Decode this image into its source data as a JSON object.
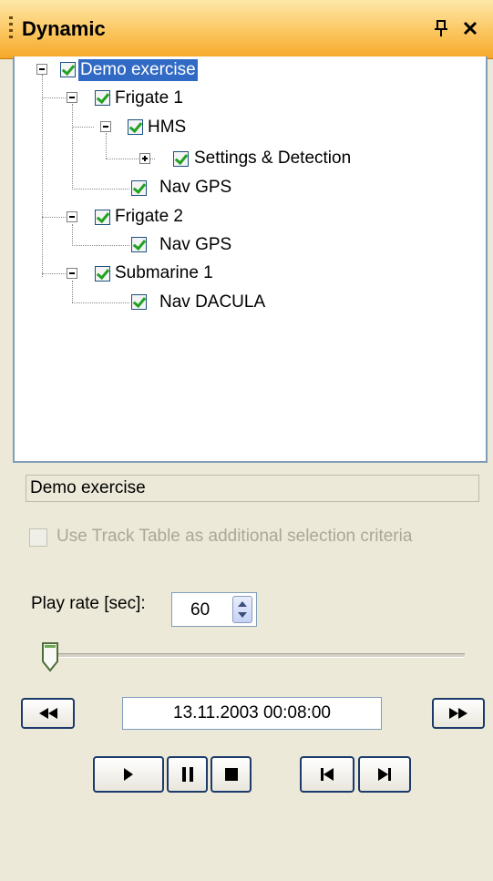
{
  "panel": {
    "title": "Dynamic",
    "pin_icon": "pin-icon",
    "close_icon": "close-icon"
  },
  "tree": {
    "root": "Demo exercise",
    "frigate1": "Frigate 1",
    "hms": "HMS",
    "settings_detection": "Settings & Detection",
    "nav_gps_1": "Nav GPS",
    "frigate2": "Frigate 2",
    "nav_gps_2": "Nav GPS",
    "submarine1": "Submarine 1",
    "nav_dacula": "Nav DACULA"
  },
  "selection": {
    "current": "Demo exercise",
    "track_table_option": "Use Track Table as additional selection criteria"
  },
  "playback": {
    "rate_label": "Play rate [sec]:",
    "rate_value": "60",
    "timeline_position": 0,
    "datetime": "13.11.2003 00:08:00",
    "buttons": [
      "rewind-icon",
      "fast-forward-icon",
      "play-icon",
      "pause-icon",
      "stop-icon",
      "skip-to-start-icon",
      "skip-to-end-icon"
    ]
  },
  "colors": {
    "titlebar": "#fbc65f",
    "selection": "#316ac5",
    "check": "#21a121",
    "button_border": "#1c3a6a"
  }
}
